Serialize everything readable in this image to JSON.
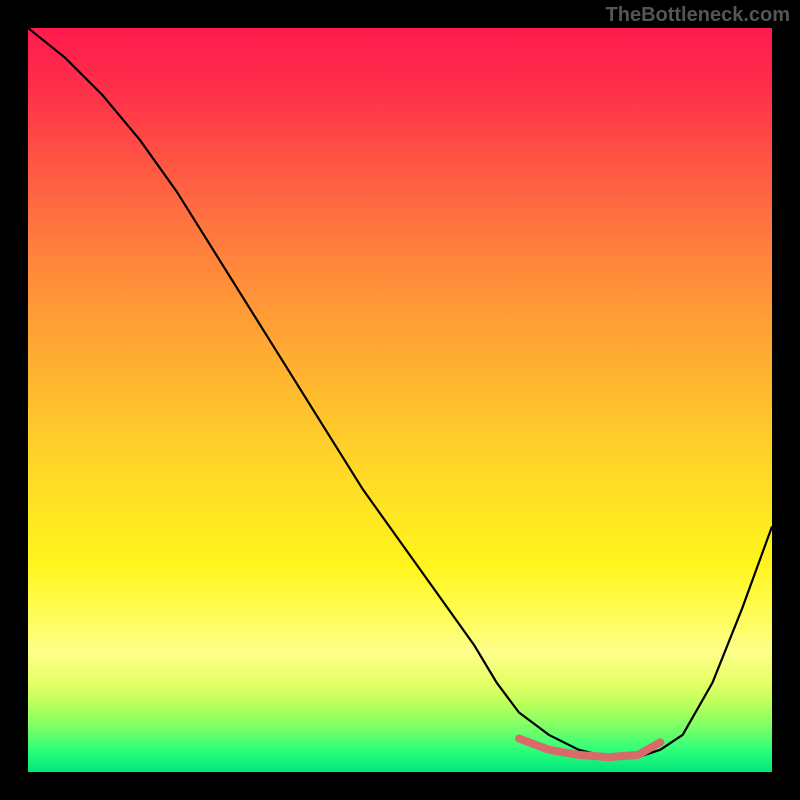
{
  "watermark": "TheBottleneck.com",
  "chart_data": {
    "type": "line",
    "title": "",
    "xlabel": "",
    "ylabel": "",
    "xlim": [
      0,
      100
    ],
    "ylim": [
      0,
      100
    ],
    "series": [
      {
        "name": "curve",
        "color": "#000000",
        "x": [
          0,
          5,
          10,
          15,
          20,
          25,
          30,
          35,
          40,
          45,
          50,
          55,
          60,
          63,
          66,
          70,
          74,
          78,
          82,
          85,
          88,
          92,
          96,
          100
        ],
        "y": [
          100,
          96,
          91,
          85,
          78,
          70,
          62,
          54,
          46,
          38,
          31,
          24,
          17,
          12,
          8,
          5,
          3,
          2,
          2,
          3,
          5,
          12,
          22,
          33
        ]
      },
      {
        "name": "highlight",
        "color": "#d96a6a",
        "x": [
          66,
          70,
          74,
          78,
          82,
          85
        ],
        "y": [
          4.5,
          3,
          2.3,
          2,
          2.3,
          4
        ]
      }
    ]
  }
}
